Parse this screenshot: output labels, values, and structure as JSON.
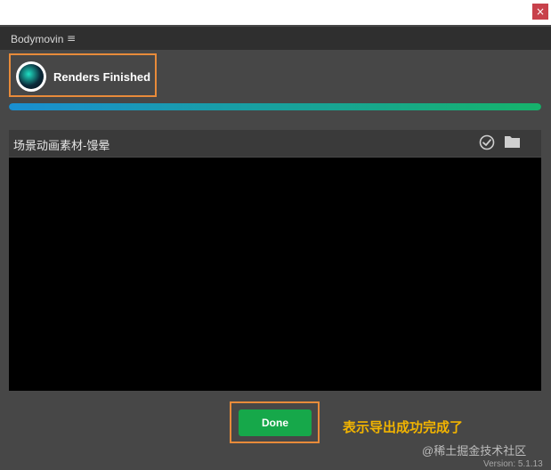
{
  "window": {
    "close_glyph": "×"
  },
  "header": {
    "title": "Bodymovin",
    "menu_glyph": "≡"
  },
  "status": {
    "text": "Renders Finished",
    "logo_icon": "bodymovin-logo-icon"
  },
  "progress": {
    "fraction": 1.0
  },
  "render_item": {
    "name": "场景动画素材-馒晕",
    "status_icon": "check-circle-icon",
    "folder_icon": "folder-icon"
  },
  "actions": {
    "done_label": "Done"
  },
  "annotation": {
    "text": "表示导出成功完成了"
  },
  "watermark": {
    "text": "@稀土掘金技术社区"
  },
  "footer": {
    "version": "Version: 5.1.13"
  },
  "colors": {
    "panel_bg": "#474747",
    "header_bg": "#2f2f2f",
    "highlight_border": "#e88b3a",
    "done_green": "#16a84a",
    "annotation_yellow": "#f2b400",
    "progress_start": "#1a8fd1",
    "progress_end": "#16b36b"
  }
}
